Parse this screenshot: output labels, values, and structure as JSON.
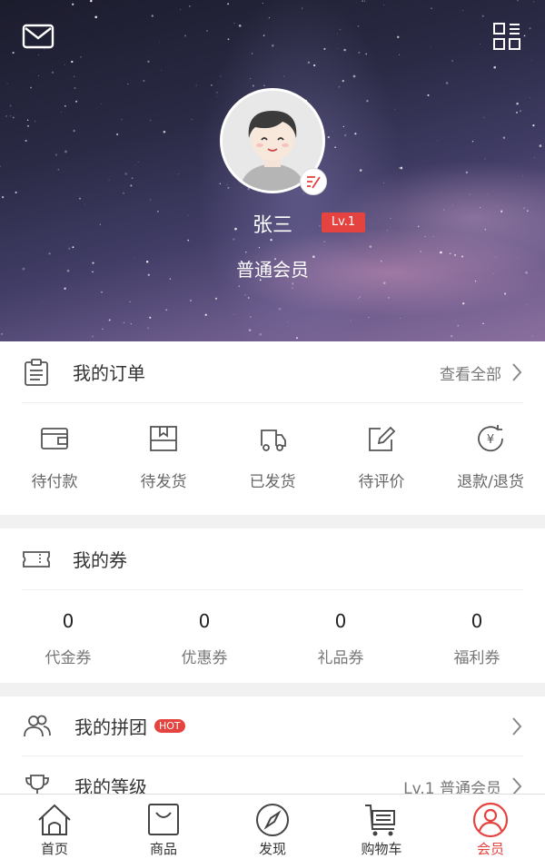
{
  "profile": {
    "name": "张三",
    "level": "Lv.1",
    "member_type": "普通会员"
  },
  "orders": {
    "title": "我的订单",
    "view_all": "查看全部",
    "items": [
      {
        "label": "待付款",
        "icon": "wallet-icon"
      },
      {
        "label": "待发货",
        "icon": "package-icon"
      },
      {
        "label": "已发货",
        "icon": "truck-icon"
      },
      {
        "label": "待评价",
        "icon": "review-icon"
      },
      {
        "label": "退款/退货",
        "icon": "refund-icon"
      }
    ]
  },
  "coupons": {
    "title": "我的券",
    "items": [
      {
        "count": "0",
        "label": "代金券"
      },
      {
        "count": "0",
        "label": "优惠券"
      },
      {
        "count": "0",
        "label": "礼品券"
      },
      {
        "count": "0",
        "label": "福利券"
      }
    ]
  },
  "group_buy": {
    "title": "我的拼团",
    "badge": "HOT"
  },
  "membership_level": {
    "title": "我的等级",
    "value": "Lv.1 普通会员"
  },
  "tabbar": {
    "items": [
      {
        "label": "首页",
        "icon": "home-icon"
      },
      {
        "label": "商品",
        "icon": "shopping-bag-icon"
      },
      {
        "label": "发现",
        "icon": "compass-icon"
      },
      {
        "label": "购物车",
        "icon": "cart-icon"
      },
      {
        "label": "会员",
        "icon": "user-icon",
        "active": true
      }
    ]
  },
  "colors": {
    "accent": "#e5433f",
    "text": "#333333",
    "muted": "#777777"
  }
}
